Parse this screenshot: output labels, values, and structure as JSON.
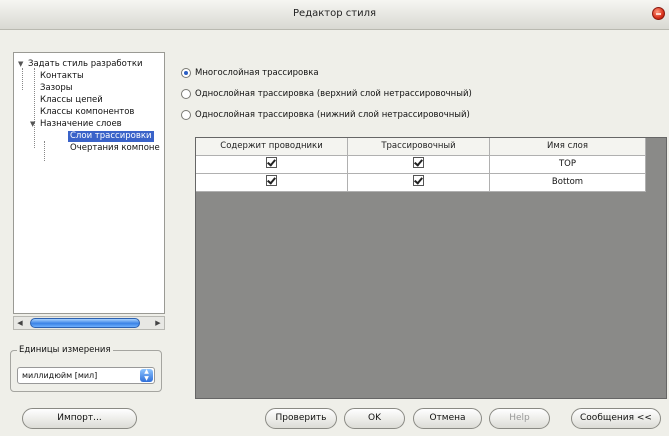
{
  "window": {
    "title": "Редактор стиля"
  },
  "tree": {
    "items": [
      {
        "label": "Задать стиль разработки",
        "twisty": "▼"
      },
      {
        "label": "Контакты"
      },
      {
        "label": "Зазоры"
      },
      {
        "label": "Классы цепей"
      },
      {
        "label": "Классы компонентов"
      },
      {
        "label": "Назначение слоев",
        "twisty": "▼"
      },
      {
        "label": "Слои трассировки"
      },
      {
        "label": "Очертания компоне"
      }
    ]
  },
  "units": {
    "group_label": "Единицы измерения",
    "selected": "миллидюйм [мил]"
  },
  "routing": {
    "options": [
      {
        "label": "Многослойная трассировка",
        "selected": true
      },
      {
        "label": "Однослойная трассировка (верхний слой нетрассировочный)",
        "selected": false
      },
      {
        "label": "Однослойная трассировка (нижний слой нетрассировочный)",
        "selected": false
      }
    ]
  },
  "table": {
    "headers": [
      "Содержит проводники",
      "Трассировочный",
      "Имя слоя"
    ],
    "rows": [
      {
        "contains_conductors": true,
        "routing": true,
        "name": "TOP"
      },
      {
        "contains_conductors": true,
        "routing": true,
        "name": "Bottom"
      }
    ]
  },
  "buttons": {
    "import": "Импорт...",
    "check": "Проверить",
    "ok": "OK",
    "cancel": "Отмена",
    "help": "Help",
    "messages": "Сообщения <<"
  }
}
